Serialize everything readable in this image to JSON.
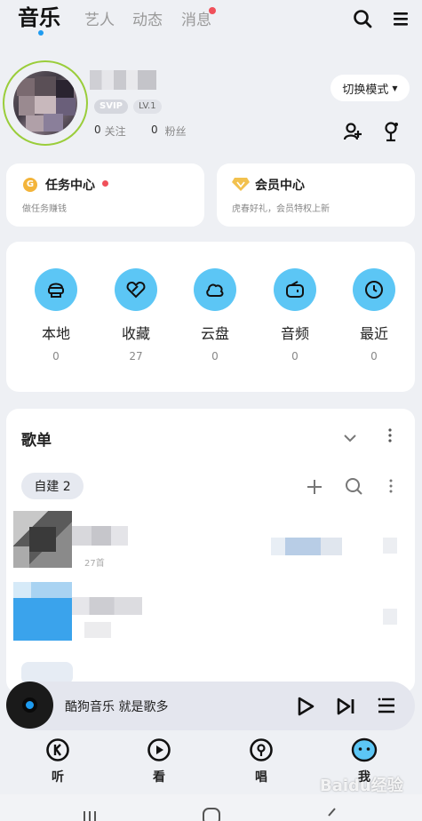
{
  "top_nav": {
    "tabs": [
      {
        "label": "音乐",
        "active": true
      },
      {
        "label": "艺人"
      },
      {
        "label": "动态"
      },
      {
        "label": "消息",
        "has_dot": true
      }
    ],
    "icons": [
      "search-icon",
      "menu-icon"
    ]
  },
  "profile": {
    "badge_svip": "SVIP",
    "badge_level": "LV.1",
    "following_count": "0",
    "following_label": "关注",
    "fans_count": "0",
    "fans_label": "粉丝",
    "switch_mode_label": "切换模式",
    "icons": [
      "add-friend-icon",
      "sing-mic-icon"
    ]
  },
  "cards": {
    "task": {
      "title": "任务中心",
      "subtitle": "做任务赚钱",
      "icon": "coin-icon",
      "has_dot": true
    },
    "vip": {
      "title": "会员中心",
      "subtitle": "虎春好礼，会员特权上新",
      "icon": "diamond-icon"
    }
  },
  "functions": [
    {
      "label": "本地",
      "count": "0",
      "icon": "local-icon"
    },
    {
      "label": "收藏",
      "count": "27",
      "icon": "favorite-icon"
    },
    {
      "label": "云盘",
      "count": "0",
      "icon": "cloud-icon"
    },
    {
      "label": "音频",
      "count": "0",
      "icon": "radio-icon"
    },
    {
      "label": "最近",
      "count": "0",
      "icon": "clock-icon"
    }
  ],
  "playlists": {
    "title": "歌单",
    "chip_label": "自建 2",
    "items": [
      {
        "subtitle": "27首"
      }
    ]
  },
  "player": {
    "text": "酷狗音乐  就是歌多",
    "icons": [
      "play-icon",
      "next-icon",
      "playlist-icon"
    ]
  },
  "bottom_tabs": [
    {
      "label": "听",
      "icon": "listen-icon"
    },
    {
      "label": "看",
      "icon": "watch-icon"
    },
    {
      "label": "唱",
      "icon": "sing-icon"
    },
    {
      "label": "我",
      "icon": "me-icon",
      "active": true
    }
  ],
  "watermark": "Baidu经验",
  "colors": {
    "accent": "#1e9bf0",
    "function_circle": "#5cc6f5",
    "red_dot": "#f0505a",
    "avatar_ring": "#9acd3a"
  }
}
